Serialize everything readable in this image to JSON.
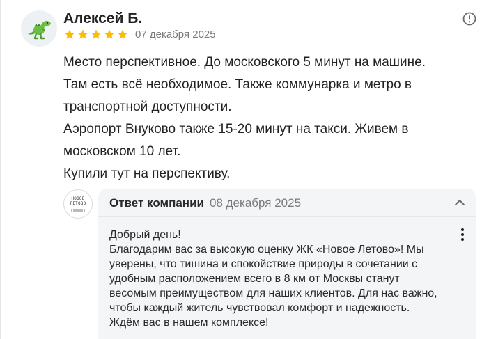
{
  "review": {
    "author_name": "Алексей Б.",
    "avatar_icon": "dinosaur-icon",
    "rating": 5,
    "rating_max": 5,
    "date": "07 декабря 2025",
    "text_lines": [
      "Место перспективное. До московского 5 минут на машине.",
      "Там есть всё необходимое. Также коммунарка и метро в",
      "транспортной доступности.",
      "Аэропорт Внуково также 15-20 минут на такси. Живем в",
      "московском 10 лет.",
      "Купили тут на перспективу."
    ]
  },
  "company_reply": {
    "logo_text_line1": "НОВОЕ",
    "logo_text_line2": "ЛЕТОВО",
    "title": "Ответ компании",
    "date": "08 декабря 2025",
    "text_lines": [
      "Добрый день!",
      "Благодарим вас за высокую оценку ЖК «Новое Летово»! Мы",
      "уверены, что тишина и спокойствие природы в сочетании с",
      "удобным расположением всего в 8 км от Москвы станут",
      "весомым преимуществом для наших клиентов. Для нас важно,",
      "чтобы каждый житель чувствовал комфорт и надежность.",
      "Ждём вас в нашем комплексе!"
    ]
  },
  "colors": {
    "star": "#fcbd00",
    "reply_background": "#f4f5f7",
    "muted_text": "#7a7a7a"
  }
}
